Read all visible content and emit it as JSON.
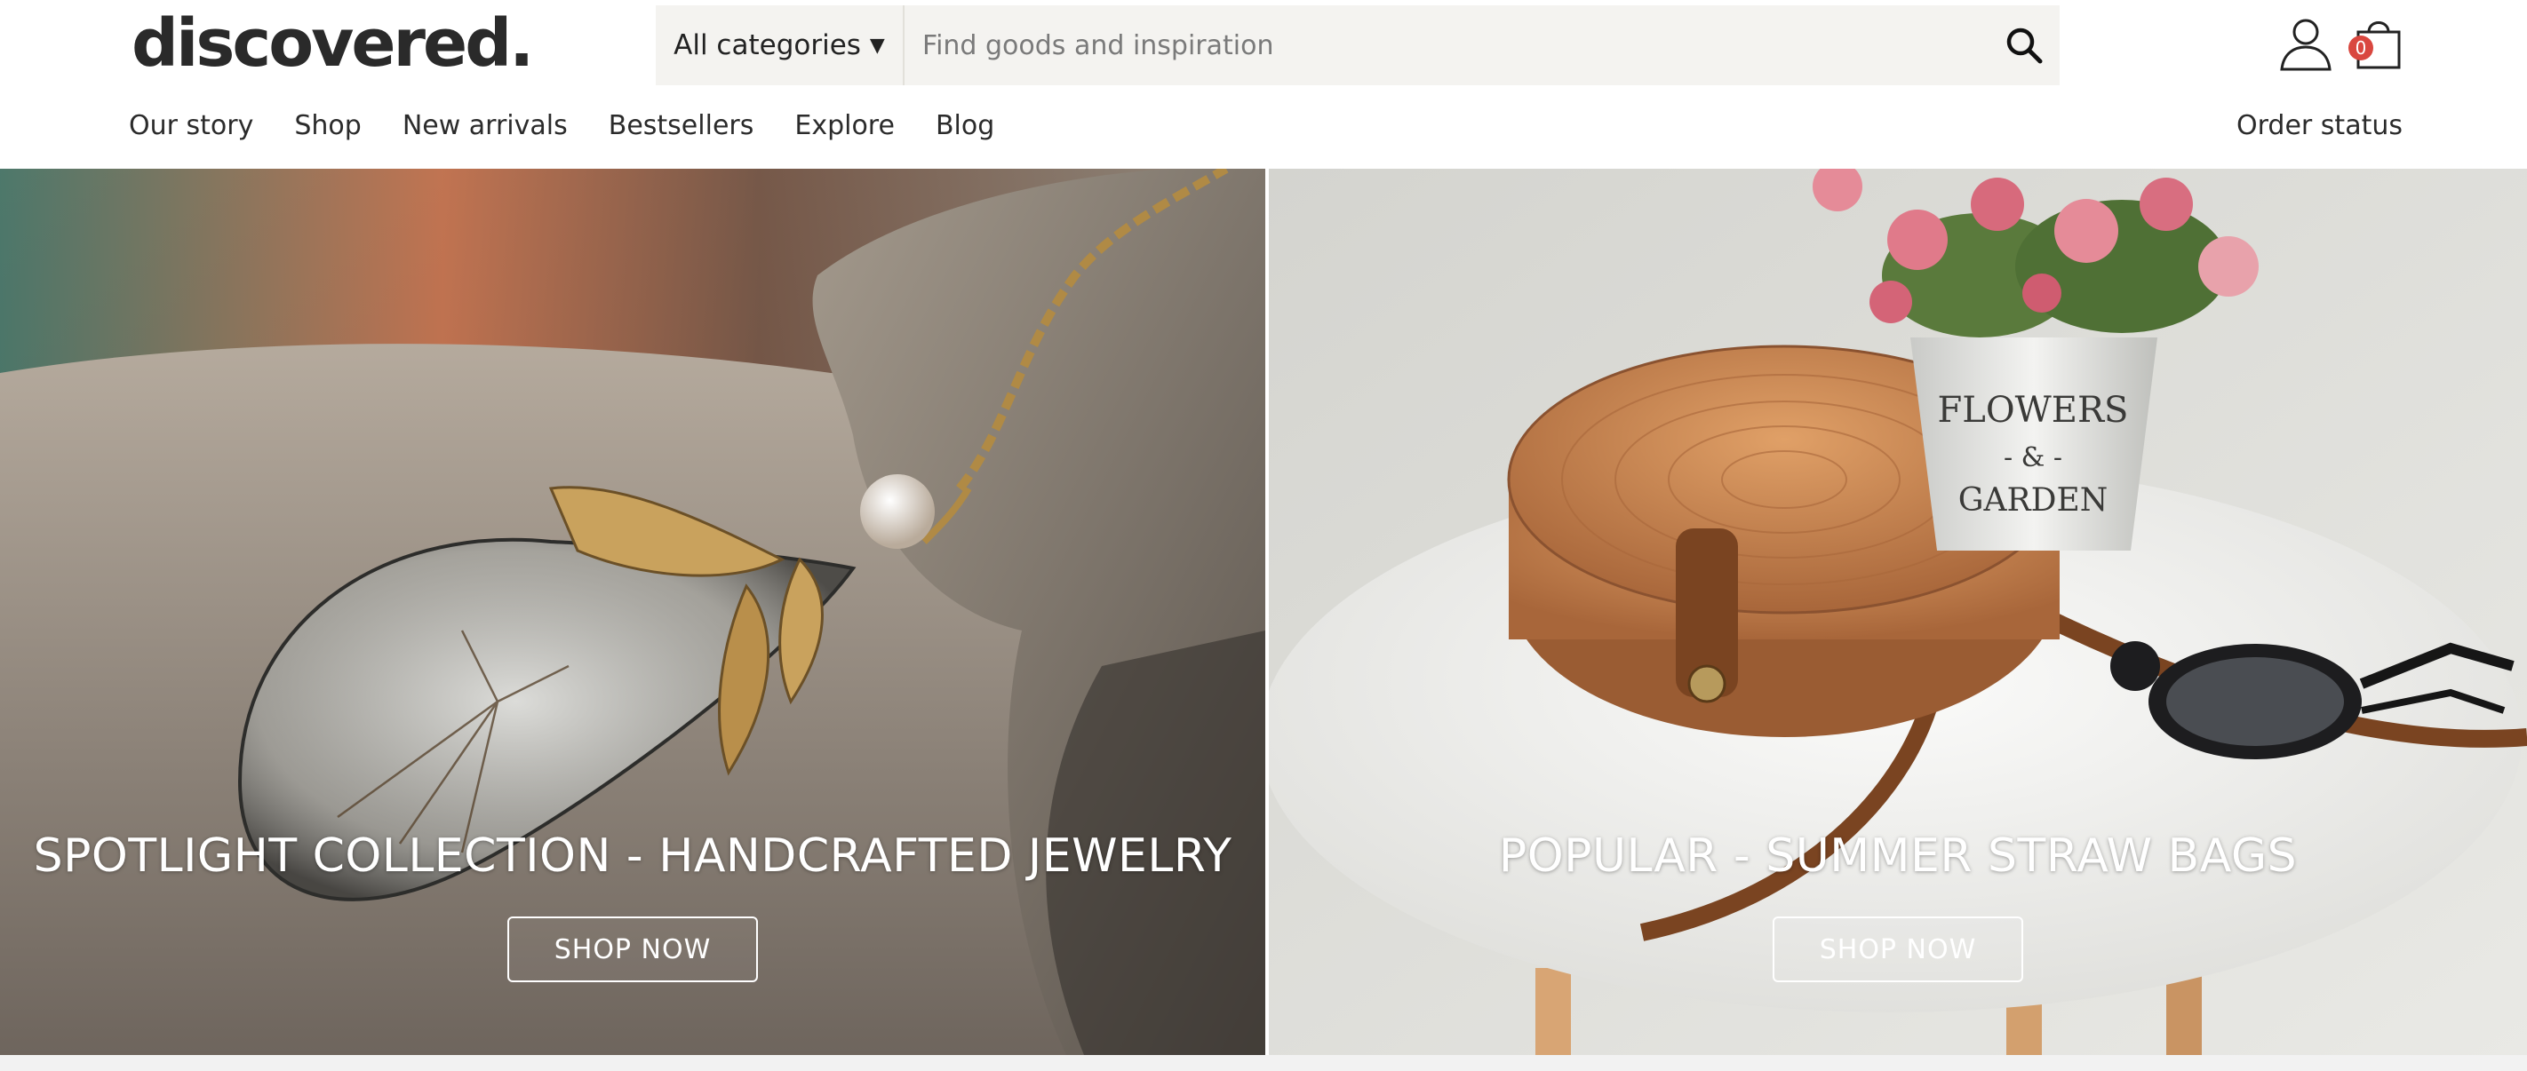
{
  "brand": {
    "logo": "discovered."
  },
  "search": {
    "category_label": "All categories",
    "placeholder": "Find goods and inspiration"
  },
  "cart": {
    "count": "0"
  },
  "nav": {
    "items": [
      "Our story",
      "Shop",
      "New arrivals",
      "Bestsellers",
      "Explore",
      "Blog"
    ],
    "order_status": "Order status"
  },
  "hero": {
    "left": {
      "title": "SPOTLIGHT COLLECTION - HANDCRAFTED JEWELRY",
      "button": "SHOP NOW"
    },
    "right": {
      "title": "POPULAR - SUMMER STRAW BAGS",
      "button": "SHOP NOW",
      "bucket_text_1": "FLOWERS",
      "bucket_text_2": "- & -",
      "bucket_text_3": "GARDEN"
    }
  },
  "icons": {
    "caret": "caret-down-icon",
    "search": "search-icon",
    "account": "user-icon",
    "bag": "shopping-bag-icon"
  }
}
